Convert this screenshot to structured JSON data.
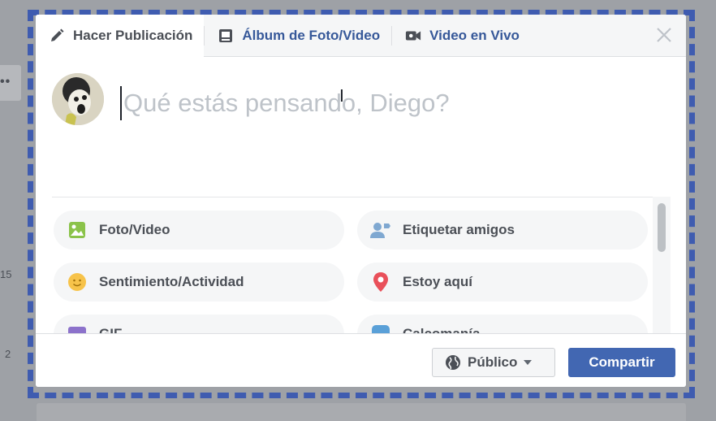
{
  "tabs": {
    "make_post": "Hacer Publicación",
    "album": "Álbum de Foto/Video",
    "live_video": "Video en Vivo"
  },
  "composer": {
    "placeholder": "Qué estás pensando, Diego?"
  },
  "options": {
    "photo_video": "Foto/Video",
    "tag_friends": "Etiquetar amigos",
    "feeling": "Sentimiento/Actividad",
    "check_in": "Estoy aquí",
    "gif": "GIF",
    "sticker": "Calcomanía"
  },
  "footer": {
    "audience": "Público",
    "share": "Compartir"
  },
  "background": {
    "count_1": "15",
    "count_2": "2"
  },
  "colors": {
    "brand_blue": "#4267b2",
    "link_blue": "#365899",
    "selection_dash": "#3f5cb0"
  },
  "icons": {
    "make_post": "pencil-icon",
    "album": "photo-album-icon",
    "live_video": "video-camera-icon",
    "close": "close-icon",
    "photo_video": "photo-icon",
    "tag_friends": "tag-friends-icon",
    "feeling": "smiley-icon",
    "check_in": "location-pin-icon",
    "gif": "gif-icon",
    "sticker": "sticker-icon",
    "audience": "globe-icon"
  }
}
